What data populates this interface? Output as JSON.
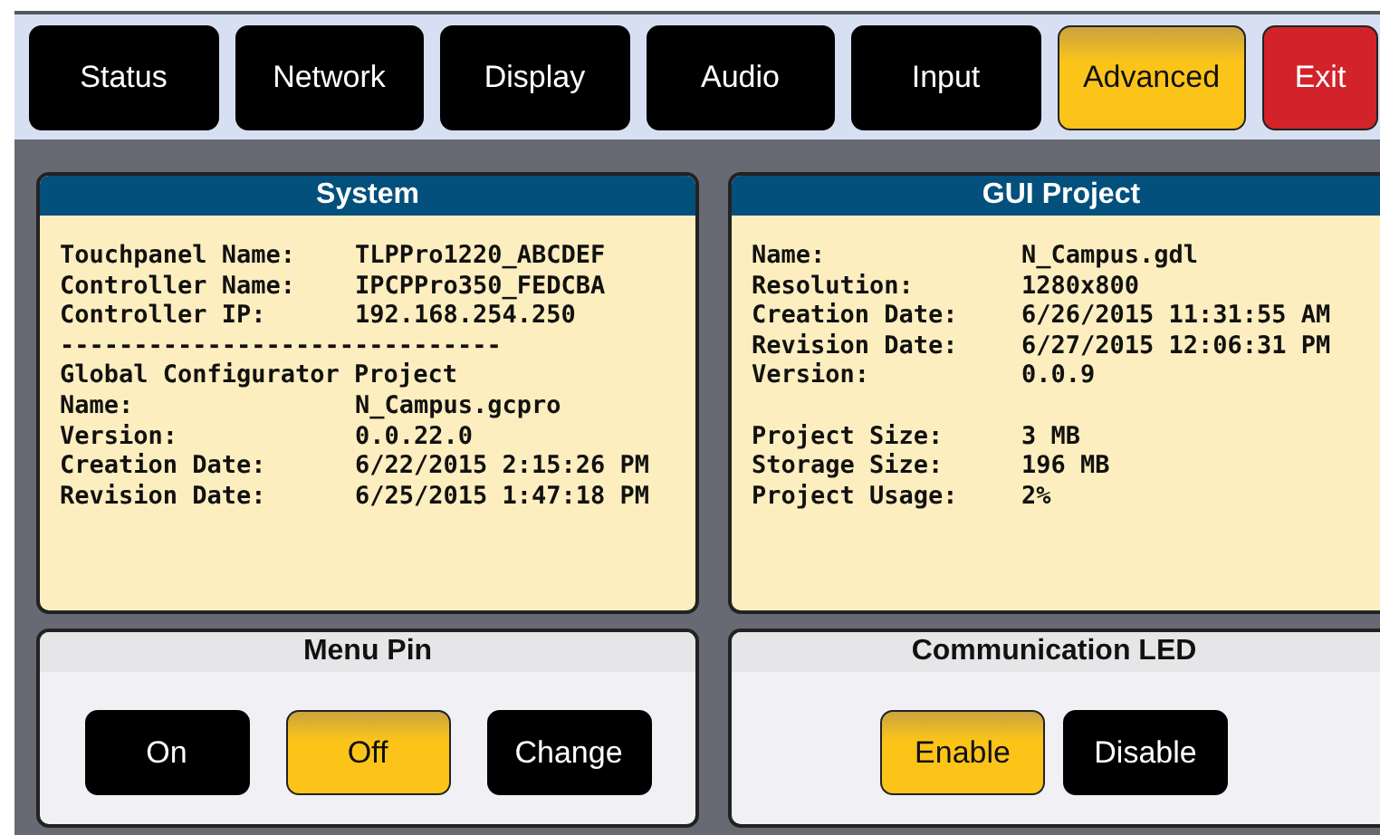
{
  "tabs": [
    {
      "label": "Status",
      "kind": "tab",
      "selected": false
    },
    {
      "label": "Network",
      "kind": "tab",
      "selected": false
    },
    {
      "label": "Display",
      "kind": "tab",
      "selected": false
    },
    {
      "label": "Audio",
      "kind": "tab",
      "selected": false
    },
    {
      "label": "Input",
      "kind": "tab",
      "selected": false
    },
    {
      "label": "Advanced",
      "kind": "tab",
      "selected": true
    },
    {
      "label": "Exit",
      "kind": "exit",
      "selected": false
    }
  ],
  "info_panels": [
    {
      "title": "System",
      "items": [
        {
          "kind": "row",
          "label": "Touchpanel Name:",
          "value": "TLPPro1220_ABCDEF"
        },
        {
          "kind": "row",
          "label": "Controller Name:",
          "value": "IPCPPro350_FEDCBA"
        },
        {
          "kind": "row",
          "label": "Controller IP:",
          "value": "192.168.254.250"
        },
        {
          "kind": "text",
          "text": "------------------------------"
        },
        {
          "kind": "text",
          "text": "Global Configurator Project"
        },
        {
          "kind": "row",
          "label": "Name:",
          "value": "N_Campus.gcpro"
        },
        {
          "kind": "row",
          "label": "Version:",
          "value": "0.0.22.0"
        },
        {
          "kind": "row",
          "label": "Creation Date:",
          "value": "6/22/2015 2:15:26 PM"
        },
        {
          "kind": "row",
          "label": "Revision Date:",
          "value": "6/25/2015 1:47:18 PM"
        }
      ]
    },
    {
      "title": "GUI Project",
      "items": [
        {
          "kind": "row",
          "label": "Name:",
          "value": "N_Campus.gdl"
        },
        {
          "kind": "row",
          "label": "Resolution:",
          "value": "1280x800"
        },
        {
          "kind": "row",
          "label": "Creation Date:",
          "value": "6/26/2015 11:31:55 AM"
        },
        {
          "kind": "row",
          "label": "Revision Date:",
          "value": "6/27/2015 12:06:31 PM"
        },
        {
          "kind": "row",
          "label": "Version:",
          "value": "0.0.9"
        },
        {
          "kind": "break"
        },
        {
          "kind": "row",
          "label": "Project Size:",
          "value": "3 MB"
        },
        {
          "kind": "row",
          "label": "Storage Size:",
          "value": "196 MB"
        },
        {
          "kind": "row",
          "label": "Project Usage:",
          "value": "2%"
        }
      ]
    }
  ],
  "control_panels": [
    {
      "title": "Menu Pin",
      "buttons": [
        {
          "label": "On",
          "selected": false
        },
        {
          "label": "Off",
          "selected": true
        },
        {
          "label": "Change",
          "selected": false
        }
      ]
    },
    {
      "title": "Communication LED",
      "buttons": [
        {
          "label": "Enable",
          "selected": true
        },
        {
          "label": "Disable",
          "selected": false
        }
      ]
    }
  ]
}
